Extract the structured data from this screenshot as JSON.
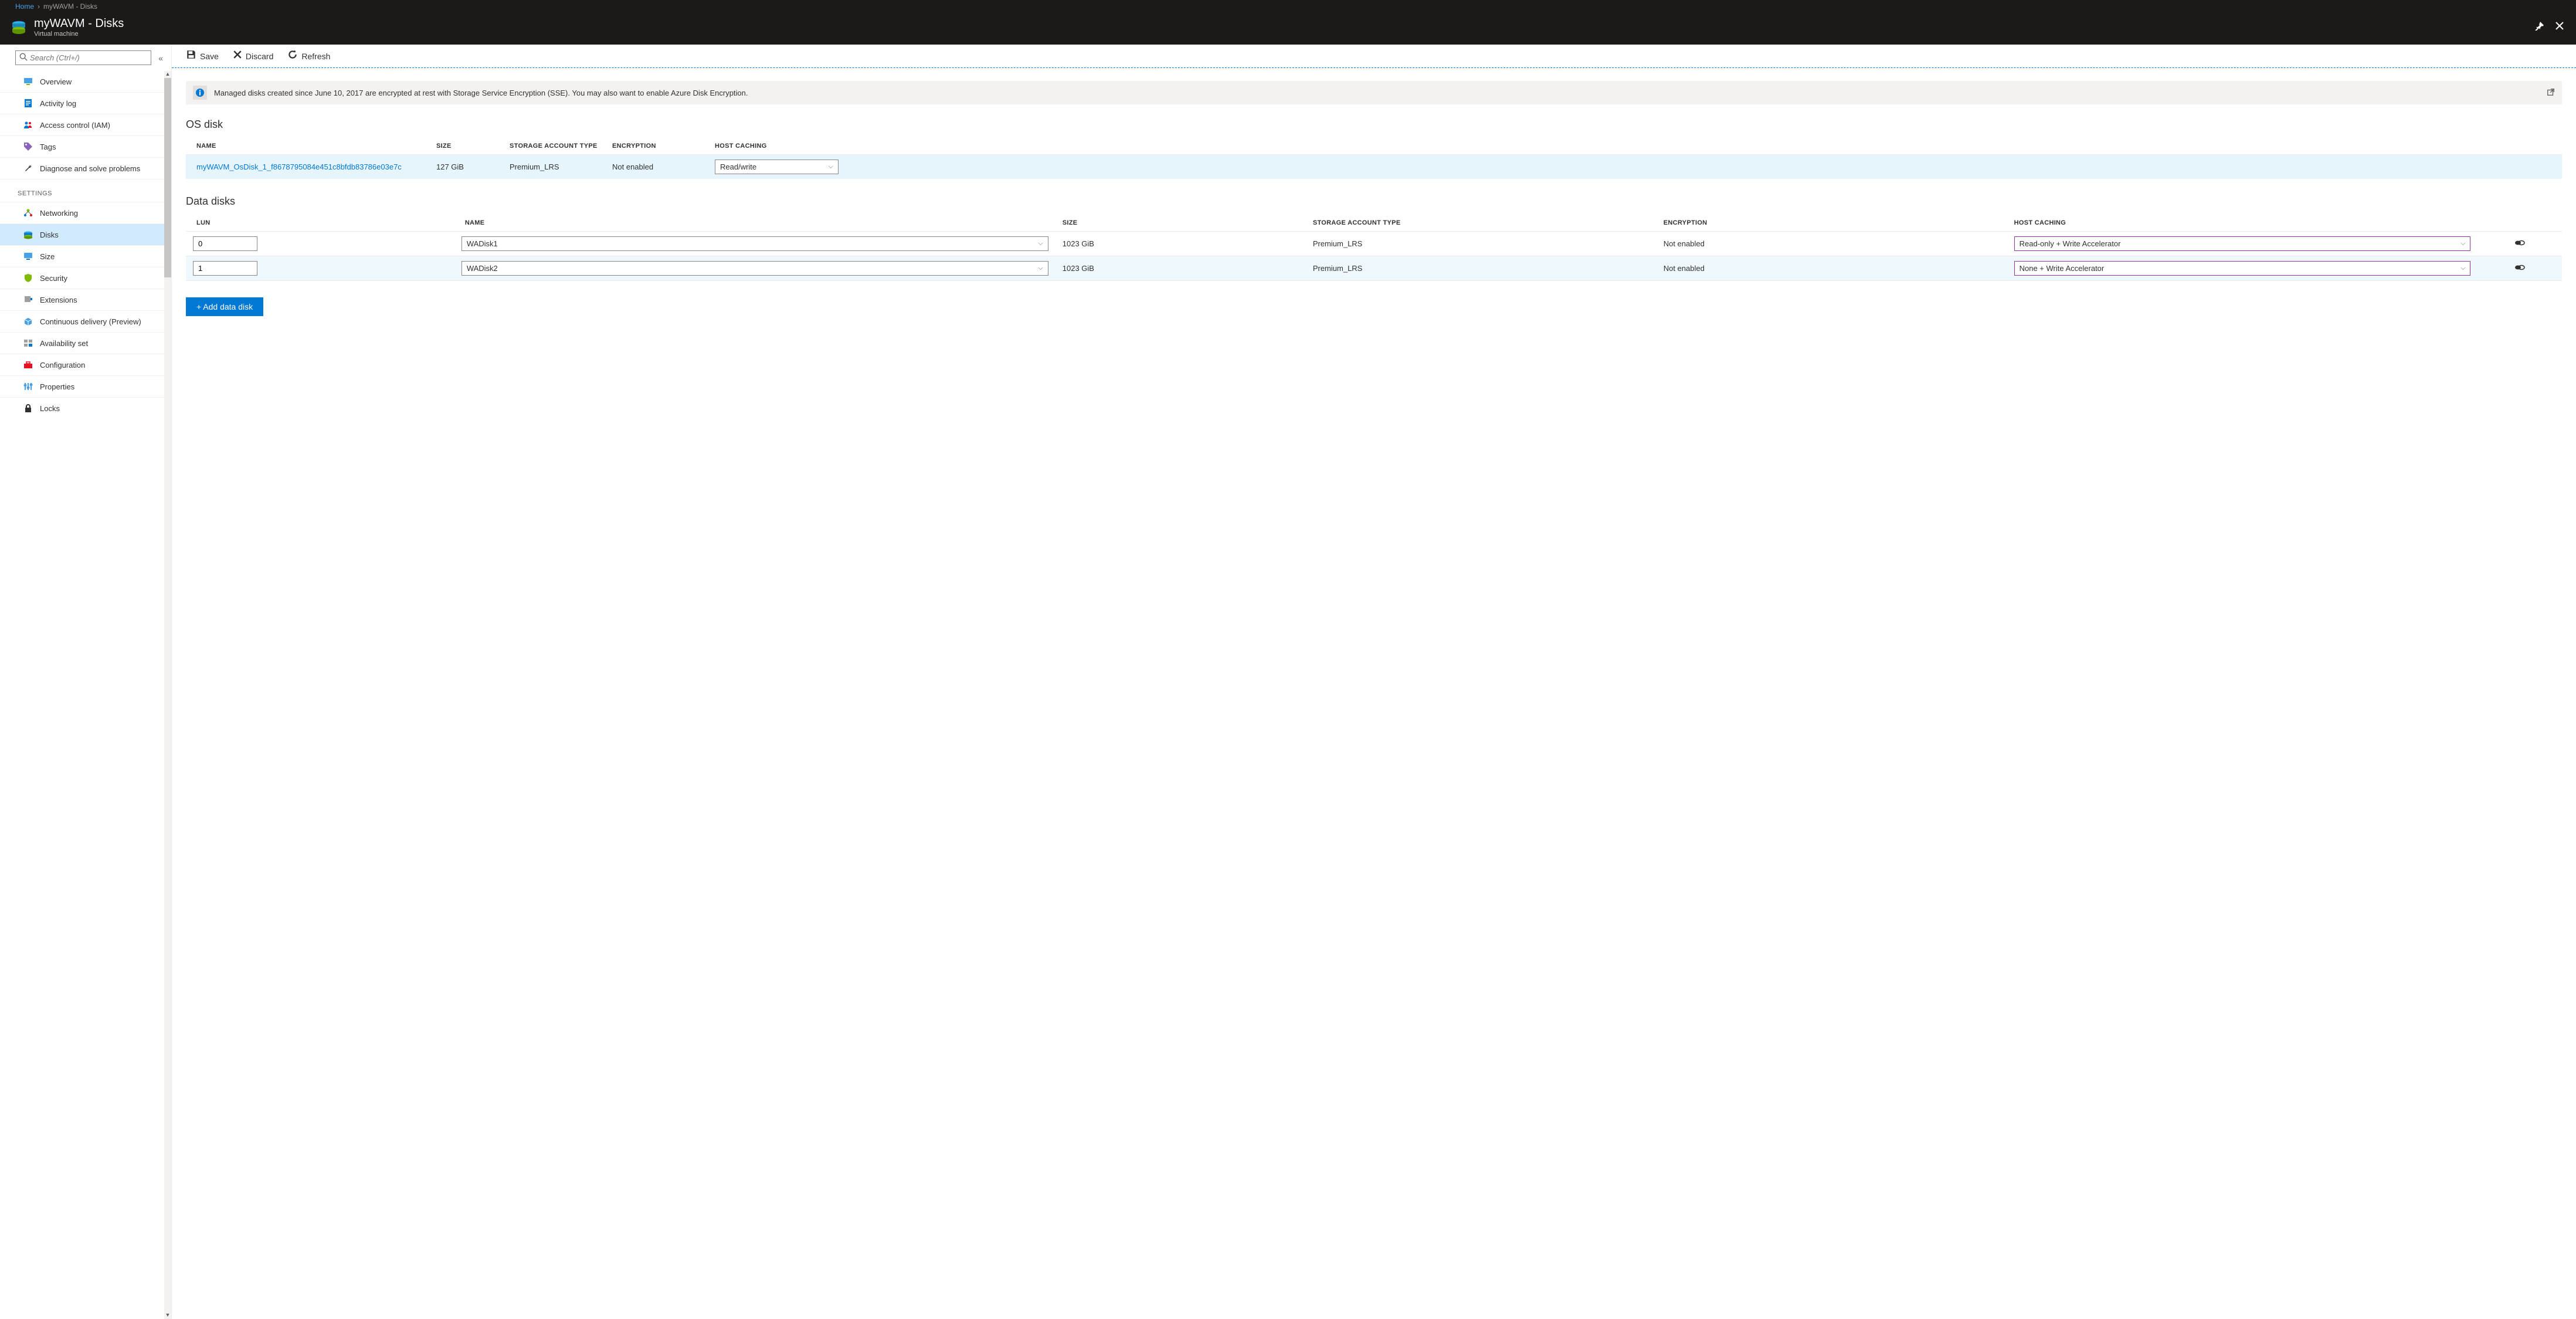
{
  "breadcrumb": {
    "home": "Home",
    "current": "myWAVM - Disks"
  },
  "header": {
    "title": "myWAVM - Disks",
    "subtitle": "Virtual machine"
  },
  "sidebar": {
    "search_placeholder": "Search (Ctrl+/)",
    "items_top": [
      {
        "label": "Overview"
      },
      {
        "label": "Activity log"
      },
      {
        "label": "Access control (IAM)"
      },
      {
        "label": "Tags"
      },
      {
        "label": "Diagnose and solve problems"
      }
    ],
    "section_settings": "SETTINGS",
    "items_settings": [
      {
        "label": "Networking"
      },
      {
        "label": "Disks"
      },
      {
        "label": "Size"
      },
      {
        "label": "Security"
      },
      {
        "label": "Extensions"
      },
      {
        "label": "Continuous delivery (Preview)"
      },
      {
        "label": "Availability set"
      },
      {
        "label": "Configuration"
      },
      {
        "label": "Properties"
      },
      {
        "label": "Locks"
      }
    ]
  },
  "toolbar": {
    "save": "Save",
    "discard": "Discard",
    "refresh": "Refresh"
  },
  "info": {
    "text": "Managed disks created since June 10, 2017 are encrypted at rest with Storage Service Encryption (SSE). You may also want to enable Azure Disk Encryption."
  },
  "os_disk": {
    "title": "OS disk",
    "headers": {
      "name": "NAME",
      "size": "SIZE",
      "sat": "STORAGE ACCOUNT TYPE",
      "enc": "ENCRYPTION",
      "hc": "HOST CACHING"
    },
    "row": {
      "name": "myWAVM_OsDisk_1_f8678795084e451c8bfdb83786e03e7c",
      "size": "127 GiB",
      "sat": "Premium_LRS",
      "enc": "Not enabled",
      "hc": "Read/write"
    }
  },
  "data_disks": {
    "title": "Data disks",
    "headers": {
      "lun": "LUN",
      "name": "NAME",
      "size": "SIZE",
      "sat": "STORAGE ACCOUNT TYPE",
      "enc": "ENCRYPTION",
      "hc": "HOST CACHING"
    },
    "rows": [
      {
        "lun": "0",
        "name": "WADisk1",
        "size": "1023 GiB",
        "sat": "Premium_LRS",
        "enc": "Not enabled",
        "hc": "Read-only + Write Accelerator"
      },
      {
        "lun": "1",
        "name": "WADisk2",
        "size": "1023 GiB",
        "sat": "Premium_LRS",
        "enc": "Not enabled",
        "hc": "None + Write Accelerator"
      }
    ],
    "add_label": "+ Add data disk"
  }
}
